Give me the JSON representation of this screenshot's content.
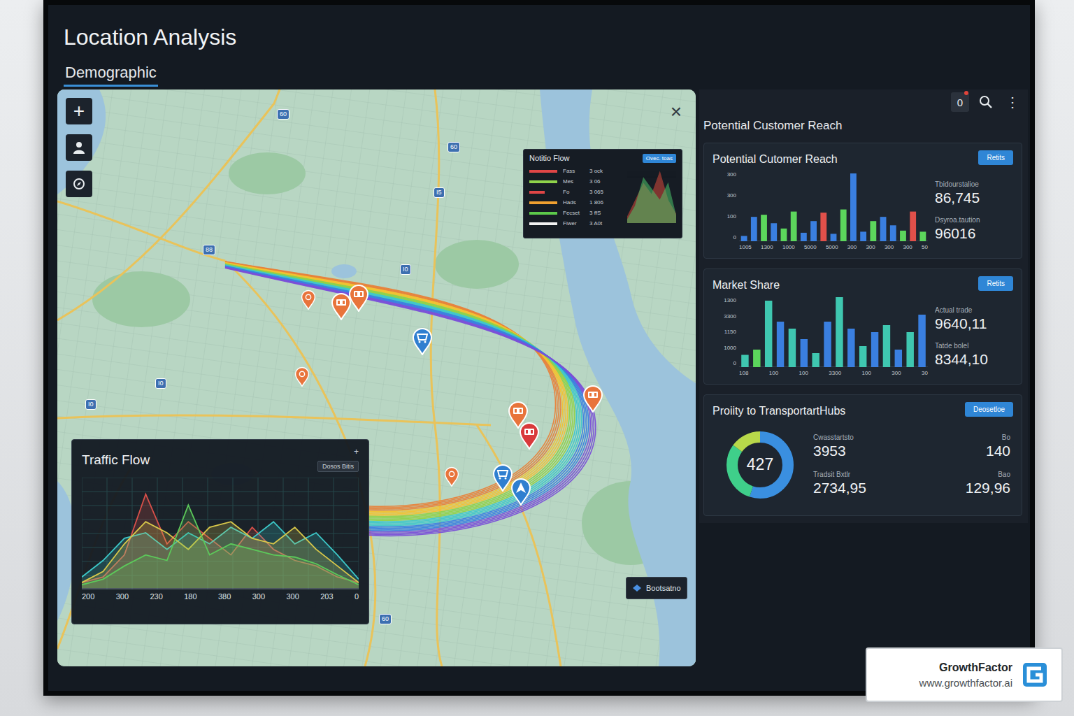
{
  "screen": {
    "title": "Location Analysis",
    "tabs": [
      {
        "label": "Demographic",
        "selected": true
      }
    ]
  },
  "map": {
    "toolbar": [
      {
        "kind": "zoom",
        "glyph": "+"
      },
      {
        "kind": "person"
      },
      {
        "kind": "compass"
      }
    ],
    "close": "×",
    "road_shields": [
      "88",
      "60",
      "60",
      "I5",
      "I0",
      "I0",
      "I0",
      "60"
    ],
    "routes": [
      {
        "color": "#e8823a"
      },
      {
        "color": "#f2c230"
      },
      {
        "color": "#8fd24a"
      },
      {
        "color": "#3fc7c9"
      },
      {
        "color": "#3a7fe0"
      },
      {
        "color": "#7a4fd8"
      }
    ],
    "pins": [
      {
        "kind": "dot",
        "color": "#e8743b"
      },
      {
        "kind": "food",
        "color": "#e8743b"
      },
      {
        "kind": "food",
        "color": "#e8743b"
      },
      {
        "kind": "shop",
        "color": "#2f7fd0"
      },
      {
        "kind": "dot",
        "color": "#e8743b"
      },
      {
        "kind": "food",
        "color": "#e8743b"
      },
      {
        "kind": "food",
        "color": "#e8743b"
      },
      {
        "kind": "food",
        "color": "#d9393b"
      },
      {
        "kind": "dot",
        "color": "#e8743b"
      },
      {
        "kind": "shop",
        "color": "#2f7fd0"
      },
      {
        "kind": "nav",
        "color": "#2f7fd0"
      }
    ],
    "legend": {
      "title": "Notitio Flow",
      "button": "Ovec. toas",
      "rows": [
        {
          "label": "Fass",
          "value": "3 ock",
          "color": "#e04646",
          "level": 0.9
        },
        {
          "label": "Mes",
          "value": "3 06",
          "color": "#8fd24a",
          "level": 0.9
        },
        {
          "label": "Fo",
          "value": "3 065",
          "color": "#e04646",
          "level": 0.5
        },
        {
          "label": "Hads",
          "value": "1 806",
          "color": "#f0a030",
          "level": 0.9
        },
        {
          "label": "Fecset",
          "value": "3 ffS",
          "color": "#5cc94a",
          "level": 0.9
        },
        {
          "label": "Fiwer",
          "value": "3 A0t",
          "color": "#f2f2f2",
          "level": 0.9
        }
      ],
      "series": [
        {
          "color": "#d84a3a",
          "values": [
            10,
            40,
            70,
            50,
            90,
            40,
            15
          ]
        },
        {
          "color": "#4cc46a",
          "values": [
            5,
            30,
            80,
            60,
            40,
            70,
            10
          ]
        }
      ]
    },
    "traffic": {
      "title": "Traffic Flow",
      "pin": "+",
      "button": "Dosos Bitis",
      "x_ticks": [
        "200",
        "300",
        "230",
        "180",
        "380",
        "300",
        "300",
        "203",
        "0"
      ],
      "series": [
        {
          "color": "#d8504a",
          "values": [
            5,
            10,
            30,
            85,
            40,
            60,
            45,
            30,
            55,
            35,
            25,
            20,
            10,
            5
          ]
        },
        {
          "color": "#3cc8c8",
          "values": [
            10,
            25,
            45,
            50,
            35,
            50,
            40,
            55,
            45,
            60,
            40,
            50,
            30,
            8
          ]
        },
        {
          "color": "#d9c84a",
          "values": [
            5,
            15,
            40,
            60,
            50,
            35,
            55,
            60,
            45,
            40,
            55,
            35,
            20,
            5
          ]
        },
        {
          "color": "#5cc95a",
          "values": [
            3,
            8,
            20,
            30,
            25,
            75,
            30,
            40,
            35,
            30,
            28,
            22,
            12,
            3
          ]
        }
      ]
    },
    "bottom_button": "Bootsatno"
  },
  "sidebar": {
    "title": "Potential Customer Reach",
    "notifications": {
      "count": "0",
      "unread": true
    },
    "menu": "⋮",
    "reach": {
      "title": "Potential Cutomer Reach",
      "button": "Retits",
      "max": 330,
      "y_ticks": [
        "300",
        "300",
        "100",
        "0"
      ],
      "x_ticks": [
        "1005",
        "1300",
        "1000",
        "5000",
        "5000",
        "300",
        "300",
        "300",
        "300",
        "50"
      ],
      "bars": [
        {
          "value": 25,
          "color": "#3a7fe0"
        },
        {
          "value": 115,
          "color": "#3a7fe0"
        },
        {
          "value": 125,
          "color": "#5cd65c"
        },
        {
          "value": 85,
          "color": "#3a7fe0"
        },
        {
          "value": 60,
          "color": "#5cd65c"
        },
        {
          "value": 140,
          "color": "#5cd65c"
        },
        {
          "value": 40,
          "color": "#3a7fe0"
        },
        {
          "value": 95,
          "color": "#3a7fe0"
        },
        {
          "value": 135,
          "color": "#e0504a"
        },
        {
          "value": 35,
          "color": "#3a7fe0"
        },
        {
          "value": 150,
          "color": "#5cd65c"
        },
        {
          "value": 320,
          "color": "#3a7fe0"
        },
        {
          "value": 45,
          "color": "#3a7fe0"
        },
        {
          "value": 95,
          "color": "#5cd65c"
        },
        {
          "value": 115,
          "color": "#3a7fe0"
        },
        {
          "value": 75,
          "color": "#3a7fe0"
        },
        {
          "value": 50,
          "color": "#5cd65c"
        },
        {
          "value": 140,
          "color": "#e0504a"
        },
        {
          "value": 45,
          "color": "#5cd65c"
        }
      ],
      "stats": [
        {
          "label": "Tbidourstalioe",
          "value": "86,745"
        },
        {
          "label": "Dsyroa.taution",
          "value": "96016"
        }
      ]
    },
    "market": {
      "title": "Market Share",
      "button": "Retits",
      "max": 400,
      "y_ticks": [
        "1300",
        "3300",
        "1150",
        "1000",
        "0"
      ],
      "x_ticks": [
        "108",
        "100",
        "100",
        "3300",
        "100",
        "300",
        "30"
      ],
      "bars": [
        {
          "value": 70,
          "color": "#3fc7b0"
        },
        {
          "value": 100,
          "color": "#5cd65c"
        },
        {
          "value": 380,
          "color": "#3fc7b0"
        },
        {
          "value": 260,
          "color": "#3a7fe0"
        },
        {
          "value": 220,
          "color": "#3fc7b0"
        },
        {
          "value": 160,
          "color": "#3a7fe0"
        },
        {
          "value": 80,
          "color": "#3fc7b0"
        },
        {
          "value": 260,
          "color": "#3a7fe0"
        },
        {
          "value": 400,
          "color": "#3fc7b0"
        },
        {
          "value": 220,
          "color": "#3a7fe0"
        },
        {
          "value": 120,
          "color": "#3fc7b0"
        },
        {
          "value": 200,
          "color": "#3a7fe0"
        },
        {
          "value": 240,
          "color": "#3fc7b0"
        },
        {
          "value": 100,
          "color": "#3a7fe0"
        },
        {
          "value": 200,
          "color": "#3fc7b0"
        },
        {
          "value": 300,
          "color": "#3a7fe0"
        }
      ],
      "stats": [
        {
          "label": "Actual trade",
          "value": "9640,11"
        },
        {
          "label": "Tatde bolel",
          "value": "8344,10"
        }
      ]
    },
    "transport": {
      "title": "Proiity to TransportartHubs",
      "button": "Deosetloe",
      "center": "427",
      "segments": [
        {
          "value": 55,
          "color": "#3a8fe0"
        },
        {
          "value": 30,
          "color": "#3fcf8a"
        },
        {
          "value": 15,
          "color": "#b8d84a"
        }
      ],
      "stats_left": [
        {
          "label": "Cwasstartsto",
          "value": "3953"
        },
        {
          "label": "Tradsit Bxtlr",
          "value": "2734,95"
        }
      ],
      "stats_right": [
        {
          "label": "Bo",
          "value": "140"
        },
        {
          "label": "Bao",
          "value": "129,96"
        }
      ]
    }
  },
  "watermark": {
    "name": "GrowthFactor",
    "url": "www.growthfactor.ai"
  }
}
